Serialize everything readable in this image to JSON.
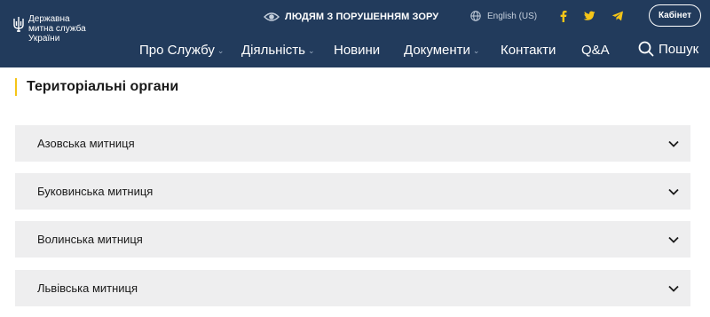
{
  "header": {
    "logo_lines": [
      "Державна",
      "митна служба",
      "України"
    ],
    "accessibility_link": "ЛЮДЯМ З ПОРУШЕННЯМ ЗОРУ",
    "language": "English (US)",
    "social": [
      "facebook-icon",
      "twitter-icon",
      "telegram-icon"
    ],
    "cabinet_label": "Кабінет",
    "nav": [
      {
        "label": "Про Службу",
        "dropdown": true
      },
      {
        "label": "Діяльність",
        "dropdown": true
      },
      {
        "label": "Новини",
        "dropdown": false
      },
      {
        "label": "Документи",
        "dropdown": true
      },
      {
        "label": "Контакти",
        "dropdown": false
      },
      {
        "label": "Q&A",
        "dropdown": false
      }
    ],
    "search_label": "Пошук"
  },
  "main": {
    "title": "Територіальні органи",
    "items": [
      {
        "label": "Азовська митниця"
      },
      {
        "label": "Буковинська митниця"
      },
      {
        "label": "Волинська митниця"
      },
      {
        "label": "Львівська митниця"
      }
    ]
  },
  "colors": {
    "header_bg": "#223b5c",
    "accent": "#f5c518",
    "social": "#f5c518",
    "accordion_bg": "#eeeeef"
  }
}
